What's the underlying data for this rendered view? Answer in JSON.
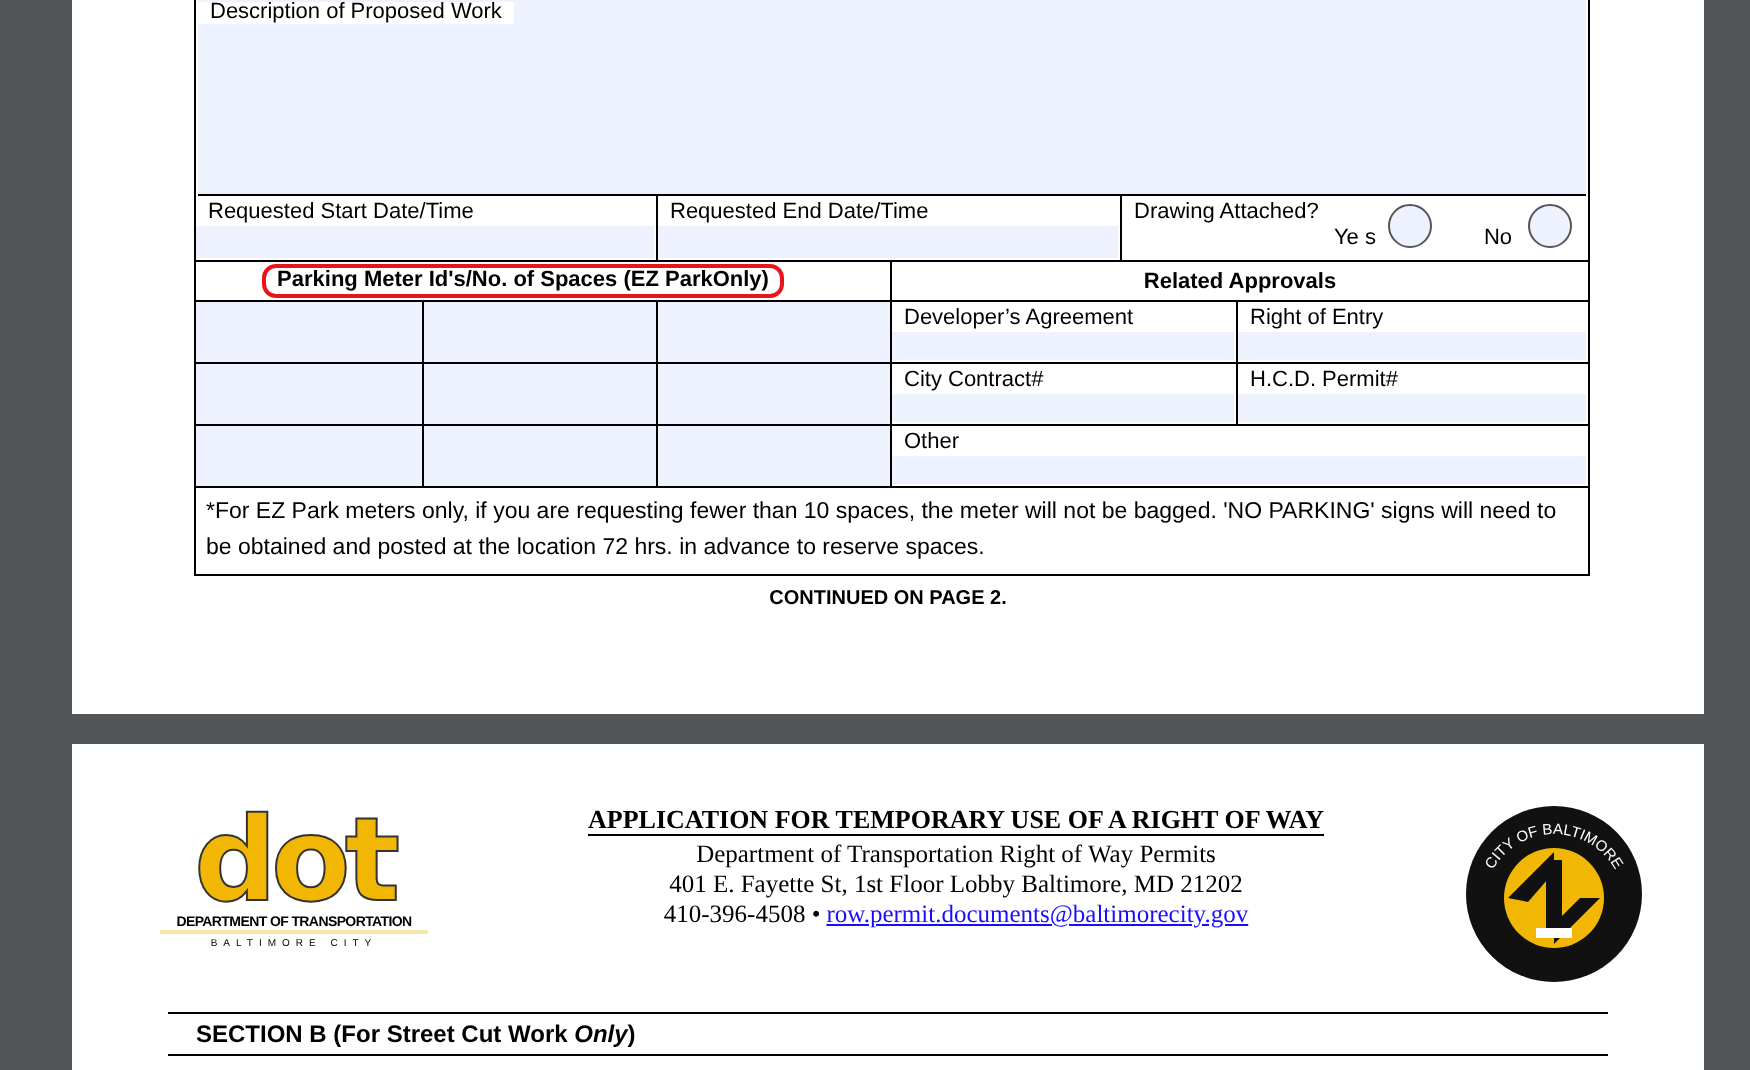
{
  "form": {
    "description_label": "Description of Proposed Work",
    "dates": [
      {
        "label": "Requested Start Date/Time"
      },
      {
        "label": "Requested End Date/Time"
      }
    ],
    "drawing": {
      "label": "Drawing Attached?",
      "options": [
        {
          "label": "Ye s",
          "checked": false
        },
        {
          "label": "No",
          "checked": false
        }
      ]
    },
    "meter_heading": "Parking Meter Id's/No. of Spaces (EZ ParkOnly)",
    "approvals_heading": "Related Approvals",
    "approvals": [
      {
        "label": "Developer’s Agreement"
      },
      {
        "label": "Right of Entry"
      },
      {
        "label": "City Contract#"
      },
      {
        "label": "H.C.D. Permit#"
      },
      {
        "label": "Other"
      }
    ],
    "note": "*For EZ Park meters only, if you are requesting fewer than 10 spaces, the meter will not be bagged. 'NO PARKING' signs will need to be obtained and posted at the location 72 hrs. in advance to reserve spaces.",
    "continued": "CONTINUED ON PAGE 2."
  },
  "page2": {
    "logo": {
      "word": "dot",
      "name": "DEPARTMENT OF TRANSPORTATION",
      "city": "BALTIMORE CITY"
    },
    "title": "APPLICATION FOR TEMPORARY USE OF A RIGHT OF WAY",
    "lines": [
      "Department of Transportation Right of Way Permits",
      "401 E. Fayette St, 1st Floor Lobby  Baltimore, MD 21202"
    ],
    "phone": "410-396-4508 •",
    "email": "row.permit.documents@baltimorecity.gov",
    "seal_text": "CITY OF BALTIMORE",
    "section": "SECTION B (For Street Cut Work *Only*)"
  }
}
